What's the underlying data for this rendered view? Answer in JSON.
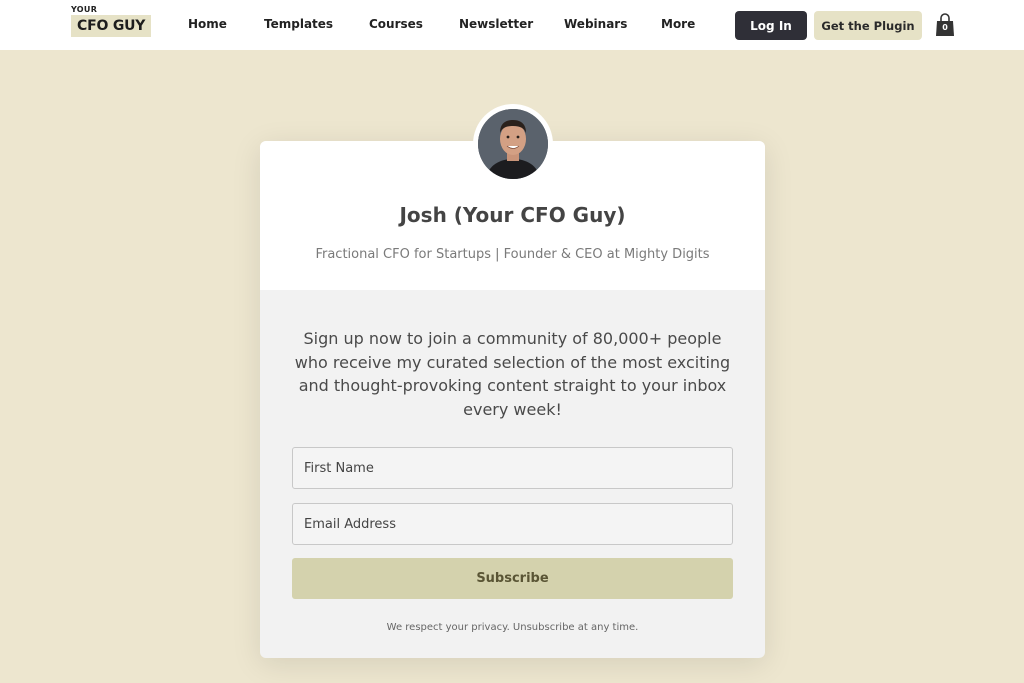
{
  "header": {
    "logo_small": "YOUR",
    "logo_main": "CFO GUY",
    "nav": [
      "Home",
      "Templates",
      "Courses",
      "Newsletter",
      "Webinars",
      "More"
    ],
    "login_label": "Log In",
    "plugin_label": "Get the Plugin",
    "cart_count": "0",
    "cart_icon": "shopping-bag-icon"
  },
  "profile": {
    "name": "Josh (Your CFO Guy)",
    "tagline": "Fractional CFO for Startups | Founder & CEO at Mighty Digits"
  },
  "signup": {
    "blurb": "Sign up now to join a community of 80,000+ people who receive my curated selection of the most exciting and thought-provoking content straight to your inbox every week!",
    "first_name_placeholder": "First Name",
    "email_placeholder": "Email Address",
    "subscribe_label": "Subscribe",
    "privacy_note": "We respect your privacy. Unsubscribe at any time."
  },
  "colors": {
    "page_bg": "#ede6cf",
    "login_bg": "#2f2f37",
    "accent_soft": "#e6e2c6",
    "subscribe_bg": "#d4d2ad"
  }
}
